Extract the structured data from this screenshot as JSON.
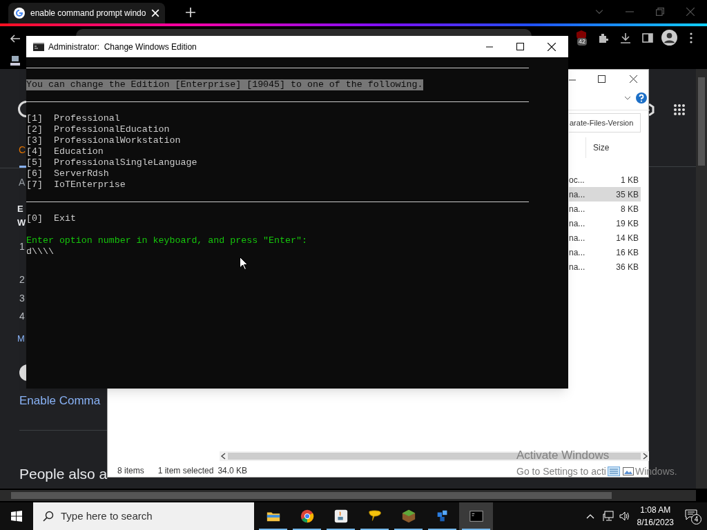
{
  "browser": {
    "tab": {
      "title": "enable command prompt windo",
      "selected": true
    },
    "extension_badge": "42",
    "page": {
      "fragments": [
        {
          "kind": "logo",
          "text": "C"
        },
        {
          "kind": "small",
          "text": "A"
        },
        {
          "kind": "bold",
          "text": "E"
        },
        {
          "kind": "bold",
          "text": "W"
        },
        {
          "kind": "num",
          "text": "1"
        },
        {
          "kind": "num",
          "text": "2"
        },
        {
          "kind": "num",
          "text": "3"
        },
        {
          "kind": "num",
          "text": "4"
        },
        {
          "kind": "link",
          "text": "M"
        }
      ],
      "link": "Enable Comma",
      "heading": "People also a"
    }
  },
  "console": {
    "title": "Administrator:  Change Windows Edition",
    "header": "You can change the Edition [Enterprise] [19045] to one of the following.",
    "options": [
      {
        "key": "[1]",
        "label": "Professional"
      },
      {
        "key": "[2]",
        "label": "ProfessionalEducation"
      },
      {
        "key": "[3]",
        "label": "ProfessionalWorkstation"
      },
      {
        "key": "[4]",
        "label": "Education"
      },
      {
        "key": "[5]",
        "label": "ProfessionalSingleLanguage"
      },
      {
        "key": "[6]",
        "label": "ServerRdsh"
      },
      {
        "key": "[7]",
        "label": "IoTEnterprise"
      }
    ],
    "exit": {
      "key": "[0]",
      "label": "Exit"
    },
    "prompt": "Enter option number in keyboard, and press \"Enter\":",
    "input": "d\\\\\\\\"
  },
  "explorer": {
    "search": "arate-Files-Version",
    "columns": [
      "Size"
    ],
    "rows": [
      {
        "name": "oc...",
        "size": "1 KB",
        "selected": false
      },
      {
        "name": "na...",
        "size": "35 KB",
        "selected": true
      },
      {
        "name": "na...",
        "size": "8 KB",
        "selected": false
      },
      {
        "name": "na...",
        "size": "19 KB",
        "selected": false
      },
      {
        "name": "na...",
        "size": "14 KB",
        "selected": false
      },
      {
        "name": "na...",
        "size": "16 KB",
        "selected": false
      },
      {
        "name": "na...",
        "size": "36 KB",
        "selected": false
      }
    ],
    "status": {
      "items": "8 items",
      "selection": "1 item selected",
      "size": "34.0 KB"
    }
  },
  "activation": {
    "title": "Activate Windows",
    "text_start": "Go to Settings to acti",
    "text_end": "Windows."
  },
  "taskbar": {
    "search_placeholder": "Type here to search",
    "apps": [
      {
        "kind": "folder",
        "active": false
      },
      {
        "kind": "chrome",
        "active": false
      },
      {
        "kind": "java",
        "active": false
      },
      {
        "kind": "chat",
        "active": false
      },
      {
        "kind": "minecraft",
        "active": false
      },
      {
        "kind": "cubes",
        "active": false
      },
      {
        "kind": "console",
        "active": true
      }
    ],
    "time": "1:08 AM",
    "date": "8/16/2023",
    "notifications": "4"
  }
}
